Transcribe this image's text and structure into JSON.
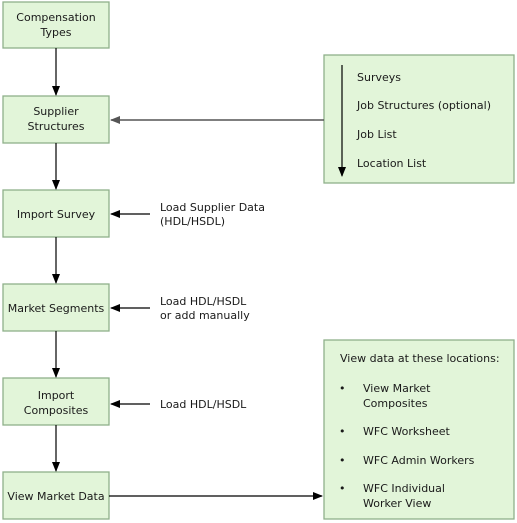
{
  "colors": {
    "box_fill": "#e2f5d9",
    "box_border": "#8fb08a",
    "arrow": "#000000"
  },
  "steps": [
    {
      "lines": [
        "Compensation",
        "Types"
      ]
    },
    {
      "lines": [
        "Supplier",
        "Structures"
      ]
    },
    {
      "lines": [
        "Import Survey"
      ]
    },
    {
      "lines": [
        "Market Segments"
      ]
    },
    {
      "lines": [
        "Import",
        "Composites"
      ]
    },
    {
      "lines": [
        "View Market Data"
      ]
    }
  ],
  "supplier_inputs": [
    "Surveys",
    "Job Structures (optional)",
    "Job List",
    "Location List"
  ],
  "side_notes": [
    {
      "lines": [
        "Load Supplier Data",
        "(HDL/HSDL)"
      ]
    },
    {
      "lines": [
        "Load HDL/HSDL",
        "or add manually"
      ]
    },
    {
      "lines": [
        "Load HDL/HSDL"
      ]
    }
  ],
  "view_locations": {
    "heading": "View data at these locations:",
    "items": [
      {
        "lines": [
          "View Market",
          "Composites"
        ]
      },
      {
        "lines": [
          "WFC Worksheet"
        ]
      },
      {
        "lines": [
          "WFC Admin Workers"
        ]
      },
      {
        "lines": [
          "WFC Individual",
          "Worker View"
        ]
      }
    ]
  }
}
